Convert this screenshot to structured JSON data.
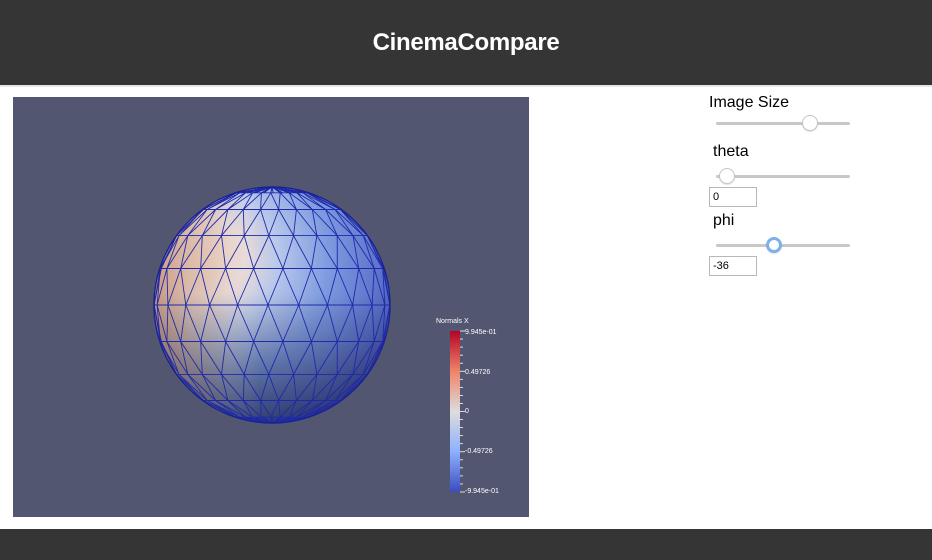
{
  "app": {
    "title": "CinemaCompare"
  },
  "viewer": {
    "legend": {
      "title": "Normals X",
      "ticks": [
        "9.945e-01",
        "0.49726",
        "0",
        "-0.49726",
        "-9.945e-01"
      ],
      "max": 0.9945,
      "min": -0.9945
    },
    "colors": {
      "background": "#525670",
      "mesh_lines": "#1f2aa8",
      "colormap_high": "#b40426",
      "colormap_mid": "#dddddd",
      "colormap_low": "#3b4cc0"
    }
  },
  "controls": {
    "image_size": {
      "label": "Image Size",
      "fraction": 0.7
    },
    "theta": {
      "label": "theta",
      "value": "0",
      "fraction": 0.08
    },
    "phi": {
      "label": "phi",
      "value": "-36",
      "fraction": 0.43
    }
  }
}
